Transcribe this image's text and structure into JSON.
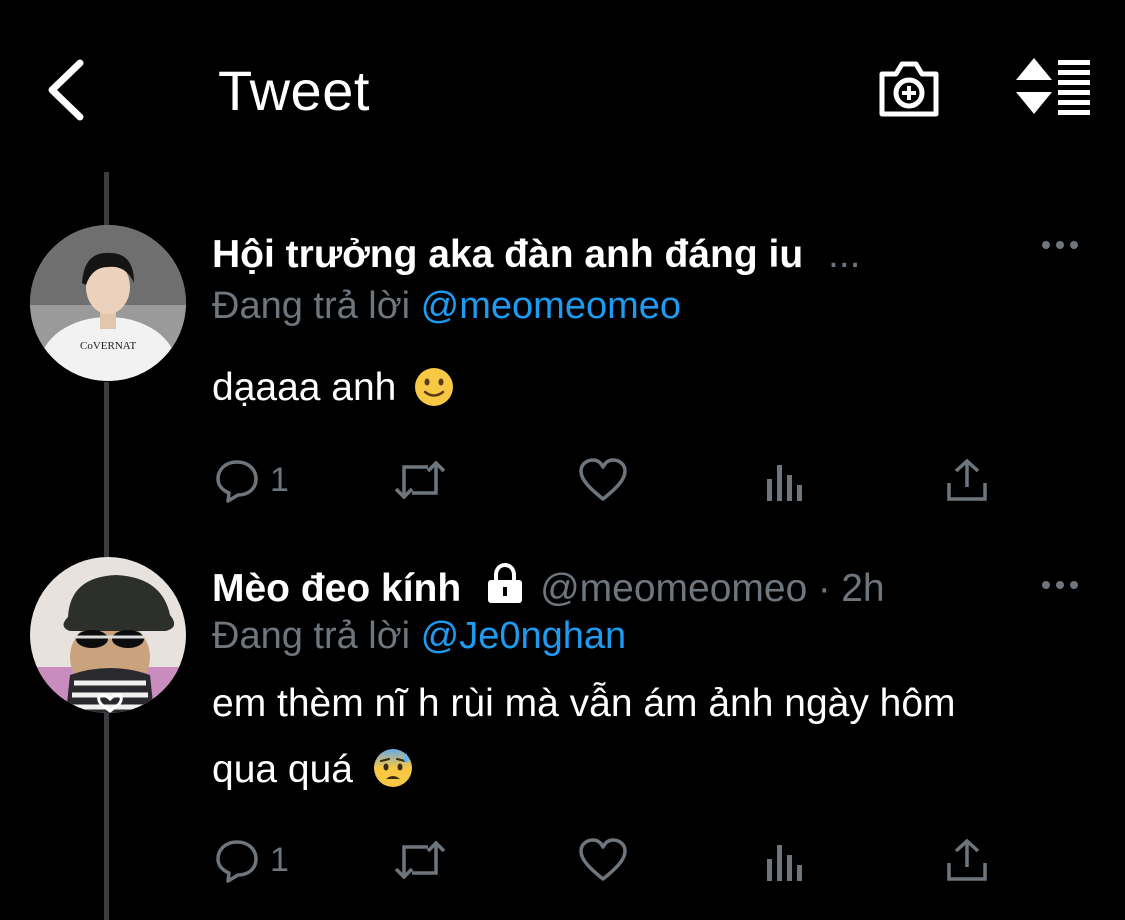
{
  "header": {
    "title": "Tweet",
    "back_icon": "chevron-left-icon",
    "camera_icon": "camera-add-icon",
    "sort_icon": "sort-icon"
  },
  "tweets": [
    {
      "display_name": "Hội trưởng aka đàn anh đáng iu",
      "truncation": "...",
      "reply_prefix": "Đang trả lời",
      "reply_to": "@meomeomeo",
      "text": "dạaaa anh",
      "emoji": "slightly-smiling-face",
      "reply_count": "1"
    },
    {
      "display_name": "Mèo đeo kính",
      "handle": "@meomeomeo",
      "time_sep": "·",
      "time": "2h",
      "locked": true,
      "reply_prefix": "Đang trả lời",
      "reply_to": "@Je0nghan",
      "text_line1": "em thèm nĩ h rùi mà vẫn ám ảnh ngày hôm",
      "text_line2": "qua quá",
      "emoji": "anxious-face-with-sweat",
      "reply_count": "1"
    }
  ],
  "colors": {
    "background": "#000000",
    "muted": "#6e767d",
    "link": "#1d9bf0",
    "thread_line": "#3a3d40"
  }
}
